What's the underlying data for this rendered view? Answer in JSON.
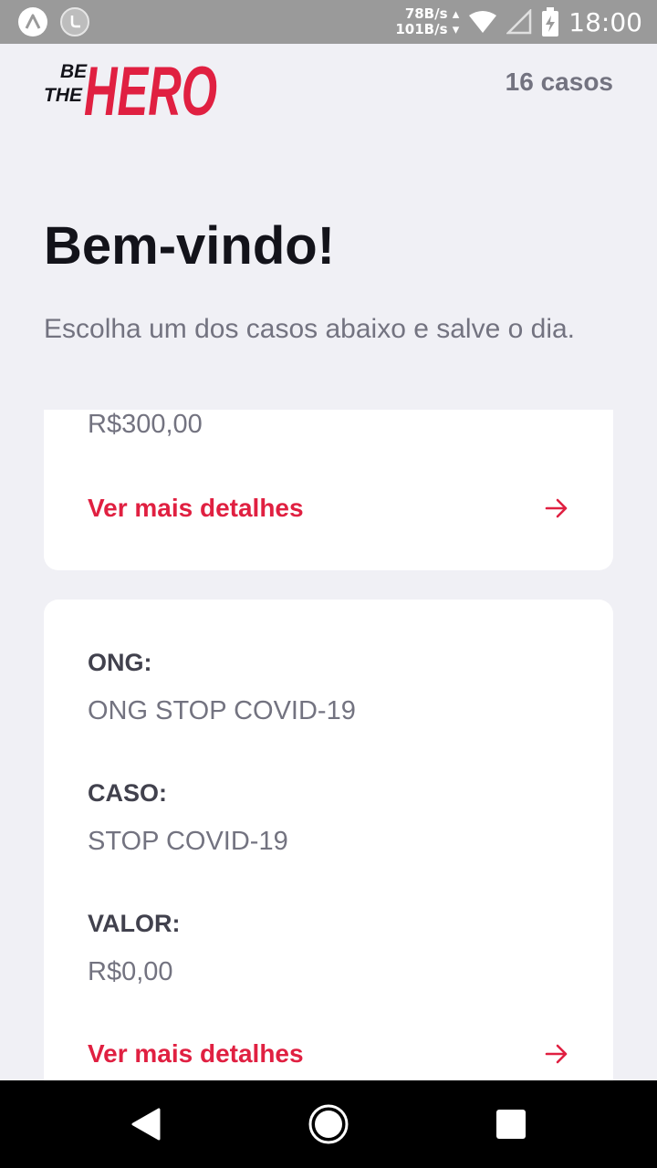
{
  "status_bar": {
    "upload_speed": "78B/s",
    "download_speed": "101B/s",
    "time": "18:00",
    "icons": [
      "app-a-icon",
      "phone-app-icon",
      "wifi-icon",
      "signal-icon",
      "battery-charging-icon"
    ]
  },
  "header": {
    "logo_small_1": "BE",
    "logo_small_2": "THE",
    "logo_big": "HERO",
    "cases_count": "16 casos"
  },
  "welcome": {
    "title": "Bem-vindo!",
    "subtitle": "Escolha um dos casos abaixo e salve o dia."
  },
  "incidents": [
    {
      "value": "R$300,00",
      "details_label": "Ver mais detalhes"
    },
    {
      "ong_label": "ONG:",
      "ong": "ONG STOP COVID-19",
      "case_label": "CASO:",
      "case": "STOP COVID-19",
      "value_label": "VALOR:",
      "value": "R$0,00",
      "details_label": "Ver mais detalhes"
    }
  ],
  "colors": {
    "brand": "#E02041",
    "background": "#F0F0F5",
    "text_dark": "#13131A",
    "text_muted": "#737380"
  }
}
